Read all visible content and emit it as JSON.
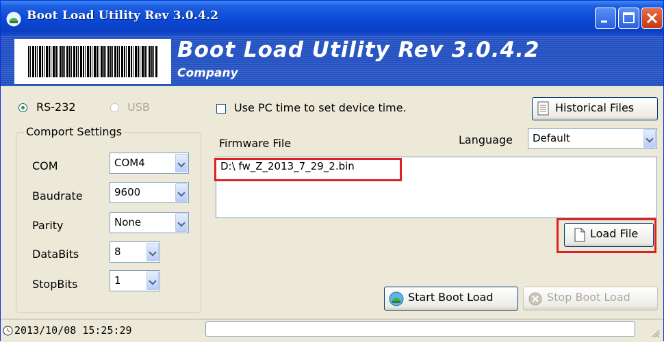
{
  "window": {
    "title": "Boot Load Utility Rev 3.0.4.2"
  },
  "banner": {
    "title": "Boot Load Utility Rev 3.0.4.2",
    "company": "Company"
  },
  "connection": {
    "rs232_label": "RS-232",
    "usb_label": "USB",
    "selected": "RS-232"
  },
  "comport": {
    "legend": "Comport Settings",
    "fields": [
      {
        "label": "COM",
        "value": "COM4"
      },
      {
        "label": "Baudrate",
        "value": "9600"
      },
      {
        "label": "Parity",
        "value": "None"
      },
      {
        "label": "DataBits",
        "value": "8"
      },
      {
        "label": "StopBits",
        "value": "1"
      }
    ]
  },
  "options": {
    "use_pc_time_label": "Use PC time to set device time.",
    "use_pc_time_checked": false
  },
  "historical_button": "Historical Files",
  "firmware": {
    "label": "Firmware File",
    "path": "D:\\ fw_Z_2013_7_29_2.bin"
  },
  "language": {
    "label": "Language",
    "value": "Default"
  },
  "load_button": "Load File",
  "start_button": "Start Boot Load",
  "stop_button": "Stop Boot Load",
  "status": {
    "datetime": "2013/10/08 15:25:29",
    "message": ""
  },
  "colors": {
    "titlebar": "#0A48D6",
    "banner": "#2351C2",
    "highlight": "#E02020",
    "window_bg": "#ECE9D8"
  }
}
